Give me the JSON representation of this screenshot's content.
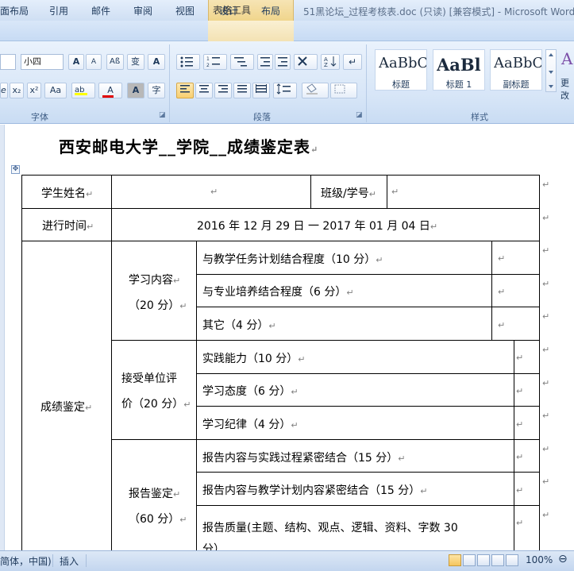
{
  "window": {
    "context_tab_group": "表格工具",
    "title": "51黑论坛_过程考核表.doc (只读) [兼容模式] - Microsoft Word"
  },
  "tabs": [
    "面布局",
    "引用",
    "邮件",
    "审阅",
    "视图",
    "设计",
    "布局"
  ],
  "ribbon": {
    "font": {
      "size": "小四",
      "group_label": "字体",
      "grow_label": "A",
      "shrink_label": "A",
      "bold_label": "A",
      "sub_label": "x₂",
      "sup_label": "x²",
      "case_label": "Aa",
      "color_label": "A",
      "shade_label": "A",
      "enclose_label": "字"
    },
    "paragraph": {
      "group_label": "段落"
    },
    "styles": {
      "group_label": "样式",
      "cards": [
        {
          "sample": "AaBbC",
          "name": "标题"
        },
        {
          "sample": "AaBl",
          "name": "标题 1"
        },
        {
          "sample": "AaBbC",
          "name": "副标题"
        }
      ],
      "more_label": "更改"
    }
  },
  "document": {
    "title": "西安邮电大学__学院__成绩鉴定表",
    "move_handle": "✥",
    "table": {
      "student_name_label": "学生姓名",
      "class_id_label": "班级/学号",
      "period_label": "进行时间",
      "period_value": "2016 年  12 月  29 日  一  2017 年  01 月 04 日",
      "grade_label": "成绩鉴定",
      "categories": [
        {
          "line1": "学习内容",
          "line2": "（20 分）"
        },
        {
          "line1": "接受单位评",
          "line2": "价（20 分）"
        },
        {
          "line1": "报告鉴定",
          "line2": "（60 分）"
        }
      ],
      "criteria": [
        "与教学任务计划结合程度（10 分）",
        "与专业培养结合程度（6 分）",
        "其它（4 分）",
        "实践能力（10 分）",
        "学习态度（6 分）",
        "学习纪律（4 分）",
        "报告内容与实践过程紧密结合（15 分）",
        "报告内容与教学计划内容紧密结合（15 分）",
        "报告质量(主题、结构、观点、逻辑、资料、字数  30",
        "分）"
      ]
    }
  },
  "status": {
    "language": "简体，中国)",
    "mode": "插入",
    "zoom": "100%"
  },
  "colors": {
    "ribbon_bg": "#d6e5f7",
    "context_tab": "#f0d58c",
    "table_border": "#000000"
  }
}
